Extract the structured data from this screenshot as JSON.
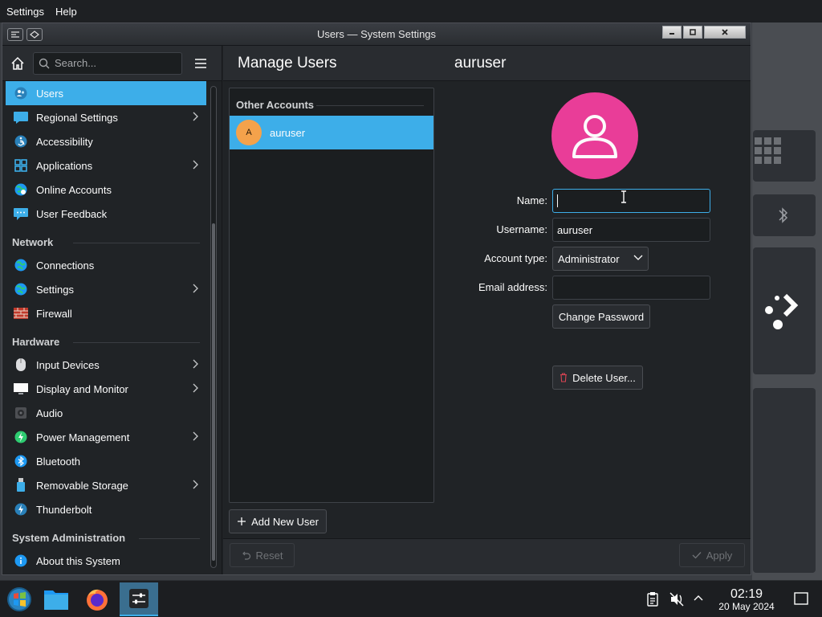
{
  "menubar": {
    "items": [
      "Settings",
      "Help"
    ]
  },
  "window": {
    "title": "Users — System Settings"
  },
  "sidebar": {
    "search_placeholder": "Search...",
    "items": [
      {
        "label": "Users",
        "icon": "users-icon",
        "active": true,
        "chevron": false
      },
      {
        "label": "Regional Settings",
        "icon": "regional-settings-icon",
        "chevron": true
      },
      {
        "label": "Accessibility",
        "icon": "accessibility-icon",
        "chevron": false
      },
      {
        "label": "Applications",
        "icon": "applications-icon",
        "chevron": true
      },
      {
        "label": "Online Accounts",
        "icon": "online-accounts-icon",
        "chevron": false
      },
      {
        "label": "User Feedback",
        "icon": "user-feedback-icon",
        "chevron": false
      }
    ],
    "section_network": "Network",
    "network_items": [
      {
        "label": "Connections",
        "icon": "globe-icon",
        "chevron": false
      },
      {
        "label": "Settings",
        "icon": "globe-icon",
        "chevron": true
      },
      {
        "label": "Firewall",
        "icon": "firewall-icon",
        "chevron": false
      }
    ],
    "section_hardware": "Hardware",
    "hardware_items": [
      {
        "label": "Input Devices",
        "icon": "mouse-icon",
        "chevron": true
      },
      {
        "label": "Display and Monitor",
        "icon": "monitor-icon",
        "chevron": true
      },
      {
        "label": "Audio",
        "icon": "speaker-icon",
        "chevron": false
      },
      {
        "label": "Power Management",
        "icon": "power-icon",
        "chevron": true
      },
      {
        "label": "Bluetooth",
        "icon": "bluetooth-icon",
        "chevron": false
      },
      {
        "label": "Removable Storage",
        "icon": "usb-icon",
        "chevron": true
      },
      {
        "label": "Thunderbolt",
        "icon": "thunderbolt-icon",
        "chevron": false
      }
    ],
    "section_sysadmin": "System Administration",
    "sysadmin_items": [
      {
        "label": "About this System",
        "icon": "info-icon",
        "chevron": false
      }
    ]
  },
  "header": {
    "title": "Manage Users",
    "user_title": "auruser"
  },
  "accounts": {
    "section_label": "Other Accounts",
    "users": [
      {
        "initial": "A",
        "name": "auruser"
      }
    ],
    "add_button": "Add New User"
  },
  "form": {
    "name_label": "Name:",
    "name_value": "",
    "username_label": "Username:",
    "username_value": "auruser",
    "account_type_label": "Account type:",
    "account_type_value": "Administrator",
    "email_label": "Email address:",
    "email_value": "",
    "change_password": "Change Password",
    "delete_user": "Delete User..."
  },
  "footer": {
    "reset": "Reset",
    "apply": "Apply"
  },
  "taskbar": {
    "time": "02:19",
    "date": "20 May 2024"
  },
  "colors": {
    "accent": "#3daee9",
    "avatar_pink": "#e93d98",
    "avatar_orange": "#f4a24b",
    "danger": "#da4453"
  }
}
